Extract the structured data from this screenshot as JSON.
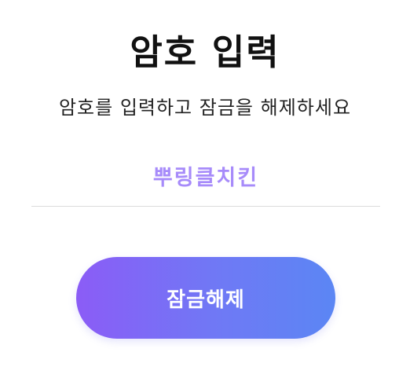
{
  "title": "암호 입력",
  "subtitle": "암호를 입력하고 잠금을 해제하세요",
  "password_input": {
    "value": "뿌링클치킨"
  },
  "unlock_button": {
    "label": "잠금해제"
  },
  "colors": {
    "background": "#ffffff",
    "title_text": "#111111",
    "input_text": "#a78bfa",
    "button_gradient_start": "#8b5cf6",
    "button_gradient_end": "#5b86f4",
    "button_text": "#ffffff",
    "divider": "#dcdcdc"
  }
}
